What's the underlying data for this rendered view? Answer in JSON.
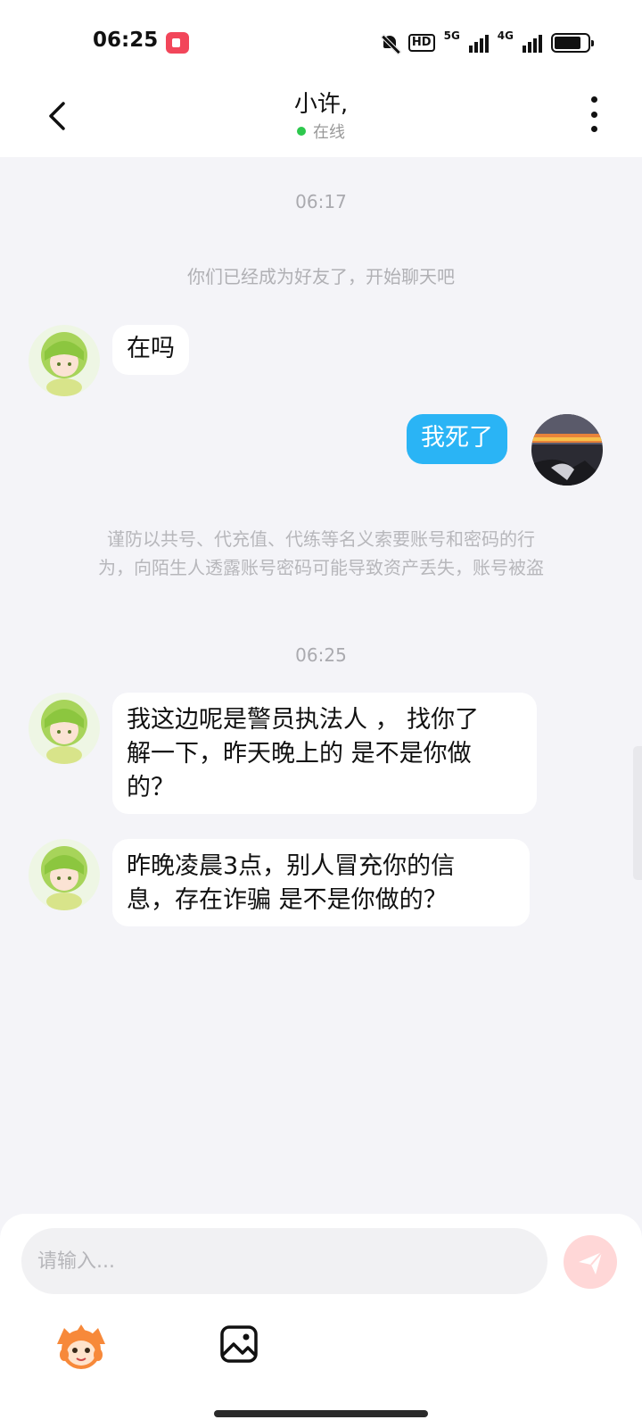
{
  "status_bar": {
    "time": "06:25",
    "hd": "HD",
    "net1": "5G",
    "net2": "4G"
  },
  "header": {
    "title": "小许,",
    "status": "在线"
  },
  "chat": {
    "time_1": "06:17",
    "system_note": "你们已经成为好友了，开始聊天吧",
    "messages": [
      {
        "from": "them",
        "text": "在吗"
      },
      {
        "from": "me",
        "text": "我死了"
      }
    ],
    "warning_line1": "谨防以共号、代充值、代练等名义索要账号和密码的行",
    "warning_line2": "为，向陌生人透露账号密码可能导致资产丢失，账号被盗",
    "time_2": "06:25",
    "messages_2": [
      {
        "from": "them",
        "line1": "我这边呢是警员执法人 ， 找你了",
        "line2": "解一下，昨天晚上的 是不是你做",
        "line3": "的？"
      },
      {
        "from": "them",
        "line1": "昨晚凌晨3点，别人冒充你的信",
        "line2": "息，存在诈骗  是不是你做的？"
      }
    ]
  },
  "composer": {
    "placeholder": "请输入..."
  },
  "icons": {
    "back": "back-arrow-icon",
    "more": "more-vertical-icon",
    "send": "send-icon",
    "emoji": "emoji-mascot-icon",
    "image": "image-picker-icon"
  },
  "colors": {
    "my_bubble": "#2ab4f5",
    "online": "#2dc84d",
    "send_button": "#ffd7d7",
    "record": "#f2465a"
  }
}
